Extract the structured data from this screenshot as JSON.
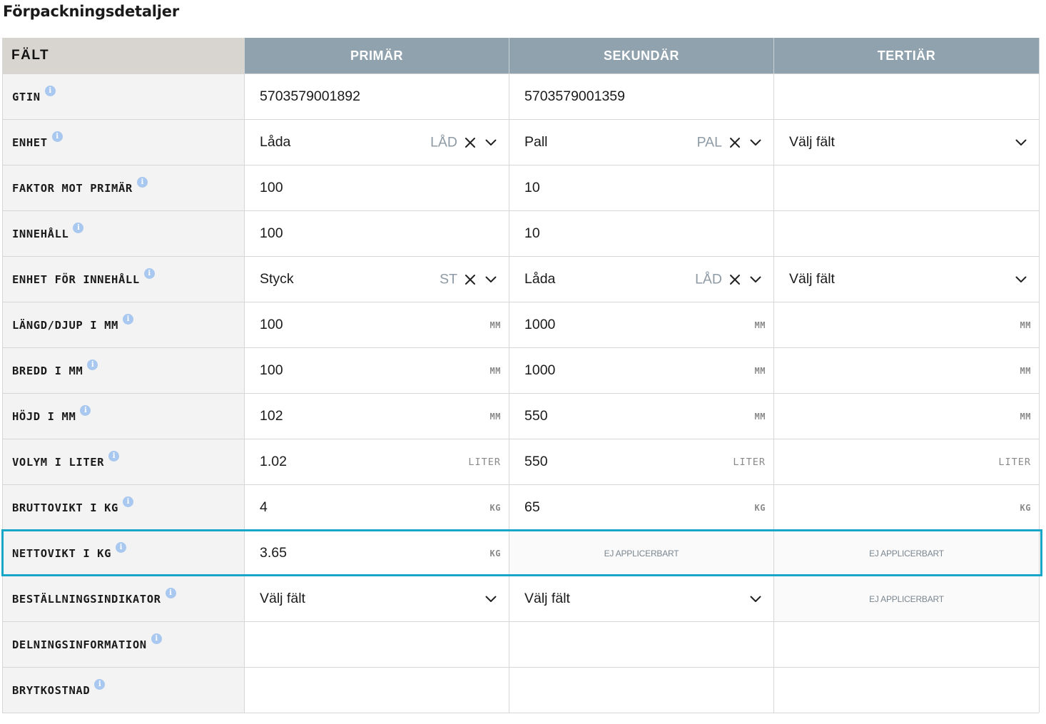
{
  "title": "Förpackningsdetaljer",
  "header": {
    "field": "FÄLT",
    "columns": [
      "PRIMÄR",
      "SEKUNDÄR",
      "TERTIÄR"
    ]
  },
  "rows": [
    {
      "label": "GTIN",
      "cells": [
        {
          "type": "text",
          "value": "5703579001892"
        },
        {
          "type": "text",
          "value": "5703579001359"
        },
        {
          "type": "text",
          "value": ""
        }
      ]
    },
    {
      "label": "ENHET",
      "cells": [
        {
          "type": "select",
          "value": "Låda",
          "code": "LÅD",
          "clearable": true
        },
        {
          "type": "select",
          "value": "Pall",
          "code": "PAL",
          "clearable": true
        },
        {
          "type": "select",
          "value": "Välj fält",
          "code": "",
          "clearable": false
        }
      ]
    },
    {
      "label": "FAKTOR MOT PRIMÄR",
      "cells": [
        {
          "type": "text",
          "value": "100"
        },
        {
          "type": "text",
          "value": "10"
        },
        {
          "type": "text",
          "value": ""
        }
      ]
    },
    {
      "label": "INNEHÅLL",
      "cells": [
        {
          "type": "text",
          "value": "100"
        },
        {
          "type": "text",
          "value": "10"
        },
        {
          "type": "text",
          "value": ""
        }
      ]
    },
    {
      "label": "ENHET FÖR INNEHÅLL",
      "cells": [
        {
          "type": "select",
          "value": "Styck",
          "code": "ST",
          "clearable": true
        },
        {
          "type": "select",
          "value": "Låda",
          "code": "LÅD",
          "clearable": true
        },
        {
          "type": "select",
          "value": "Välj fält",
          "code": "",
          "clearable": false
        }
      ]
    },
    {
      "label": "LÄNGD/DJUP I MM",
      "cells": [
        {
          "type": "unit",
          "value": "100",
          "unit": "MM"
        },
        {
          "type": "unit",
          "value": "1000",
          "unit": "MM"
        },
        {
          "type": "unit",
          "value": "",
          "unit": "MM"
        }
      ]
    },
    {
      "label": "BREDD I MM",
      "cells": [
        {
          "type": "unit",
          "value": "100",
          "unit": "MM"
        },
        {
          "type": "unit",
          "value": "1000",
          "unit": "MM"
        },
        {
          "type": "unit",
          "value": "",
          "unit": "MM"
        }
      ]
    },
    {
      "label": "HÖJD I MM",
      "cells": [
        {
          "type": "unit",
          "value": "102",
          "unit": "MM"
        },
        {
          "type": "unit",
          "value": "550",
          "unit": "MM"
        },
        {
          "type": "unit",
          "value": "",
          "unit": "MM"
        }
      ]
    },
    {
      "label": "VOLYM I LITER",
      "cells": [
        {
          "type": "unit",
          "value": "1.02",
          "unit": "LITER"
        },
        {
          "type": "unit",
          "value": "550",
          "unit": "LITER"
        },
        {
          "type": "unit",
          "value": "",
          "unit": "LITER"
        }
      ]
    },
    {
      "label": "BRUTTOVIKT I KG",
      "cells": [
        {
          "type": "unit",
          "value": "4",
          "unit": "KG"
        },
        {
          "type": "unit",
          "value": "65",
          "unit": "KG"
        },
        {
          "type": "unit",
          "value": "",
          "unit": "KG"
        }
      ]
    },
    {
      "label": "NETTOVIKT I KG",
      "highlighted": true,
      "cells": [
        {
          "type": "unit",
          "value": "3.65",
          "unit": "KG"
        },
        {
          "type": "na",
          "value": "EJ APPLICERBART"
        },
        {
          "type": "na",
          "value": "EJ APPLICERBART"
        }
      ]
    },
    {
      "label": "BESTÄLLNINGSINDIKATOR",
      "cells": [
        {
          "type": "select",
          "value": "Välj fält",
          "code": "",
          "clearable": false
        },
        {
          "type": "select",
          "value": "Välj fält",
          "code": "",
          "clearable": false
        },
        {
          "type": "na",
          "value": "EJ APPLICERBART"
        }
      ]
    },
    {
      "label": "DELNINGSINFORMATION",
      "cells": [
        {
          "type": "text",
          "value": ""
        },
        {
          "type": "text",
          "value": ""
        },
        {
          "type": "text",
          "value": ""
        }
      ]
    },
    {
      "label": "BRYTKOSTNAD",
      "cells": [
        {
          "type": "text",
          "value": ""
        },
        {
          "type": "text",
          "value": ""
        },
        {
          "type": "text",
          "value": ""
        }
      ]
    }
  ],
  "colors": {
    "header_bg": "#8fa2ae",
    "field_header_bg": "#d8d5d0",
    "highlight": "#17a6c8",
    "info_icon": "#a8c8f0"
  },
  "icons": {
    "info": "info-icon",
    "clear": "close-icon",
    "dropdown": "chevron-down-icon"
  }
}
